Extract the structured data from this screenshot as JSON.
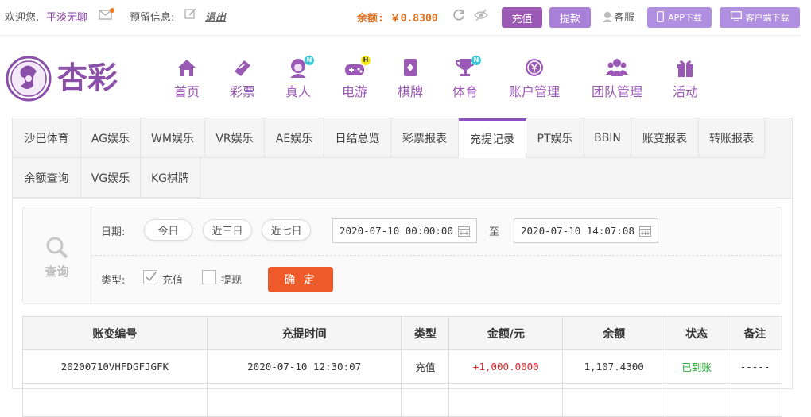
{
  "topbar": {
    "welcome": "欢迎您,",
    "username": "平淡无聊",
    "reserved_info": "预留信息:",
    "logout": "退出",
    "balance": "余额: ￥0.8300",
    "deposit": "充值",
    "withdraw": "提款",
    "service": "客服",
    "app_download": "APP下载",
    "client_download": "客户端下载",
    "colors": {
      "accent": "#9b59b6",
      "balance": "#e0701e"
    }
  },
  "brand": {
    "name": "杏彩"
  },
  "nav": [
    {
      "label": "首页",
      "icon": "home-icon"
    },
    {
      "label": "彩票",
      "icon": "lottery-ticket-icon"
    },
    {
      "label": "真人",
      "icon": "live-dealer-icon",
      "badge": "N"
    },
    {
      "label": "电游",
      "icon": "gamepad-icon",
      "badge": "H"
    },
    {
      "label": "棋牌",
      "icon": "cards-icon"
    },
    {
      "label": "体育",
      "icon": "trophy-icon",
      "badge": "N"
    },
    {
      "label": "账户管理",
      "icon": "coin-icon"
    },
    {
      "label": "团队管理",
      "icon": "team-icon"
    },
    {
      "label": "活动",
      "icon": "gift-icon"
    }
  ],
  "tabs": [
    "沙巴体育",
    "AG娱乐",
    "WM娱乐",
    "VR娱乐",
    "AE娱乐",
    "日结总览",
    "彩票报表",
    "充提记录",
    "PT娱乐",
    "BBIN",
    "账变报表",
    "转账报表",
    "余额查询",
    "VG娱乐",
    "KG棋牌"
  ],
  "active_tab": "充提记录",
  "query": {
    "title": "查询",
    "date_label": "日期:",
    "quick": [
      "今日",
      "近三日",
      "近七日"
    ],
    "start": "2020-07-10 00:00:00",
    "to": "至",
    "end": "2020-07-10 14:07:08",
    "type_label": "类型:",
    "types": [
      {
        "label": "充值",
        "checked": true
      },
      {
        "label": "提现",
        "checked": false
      }
    ],
    "confirm": "确 定"
  },
  "table": {
    "headers": [
      "账变编号",
      "充提时间",
      "类型",
      "金额/元",
      "余额",
      "状态",
      "备注"
    ],
    "rows": [
      [
        "20200710VHFDGFJGFK",
        "2020-07-10 12:30:07",
        "充值",
        "+1,000.0000",
        "1,107.4300",
        "已到账",
        "-----"
      ]
    ]
  }
}
